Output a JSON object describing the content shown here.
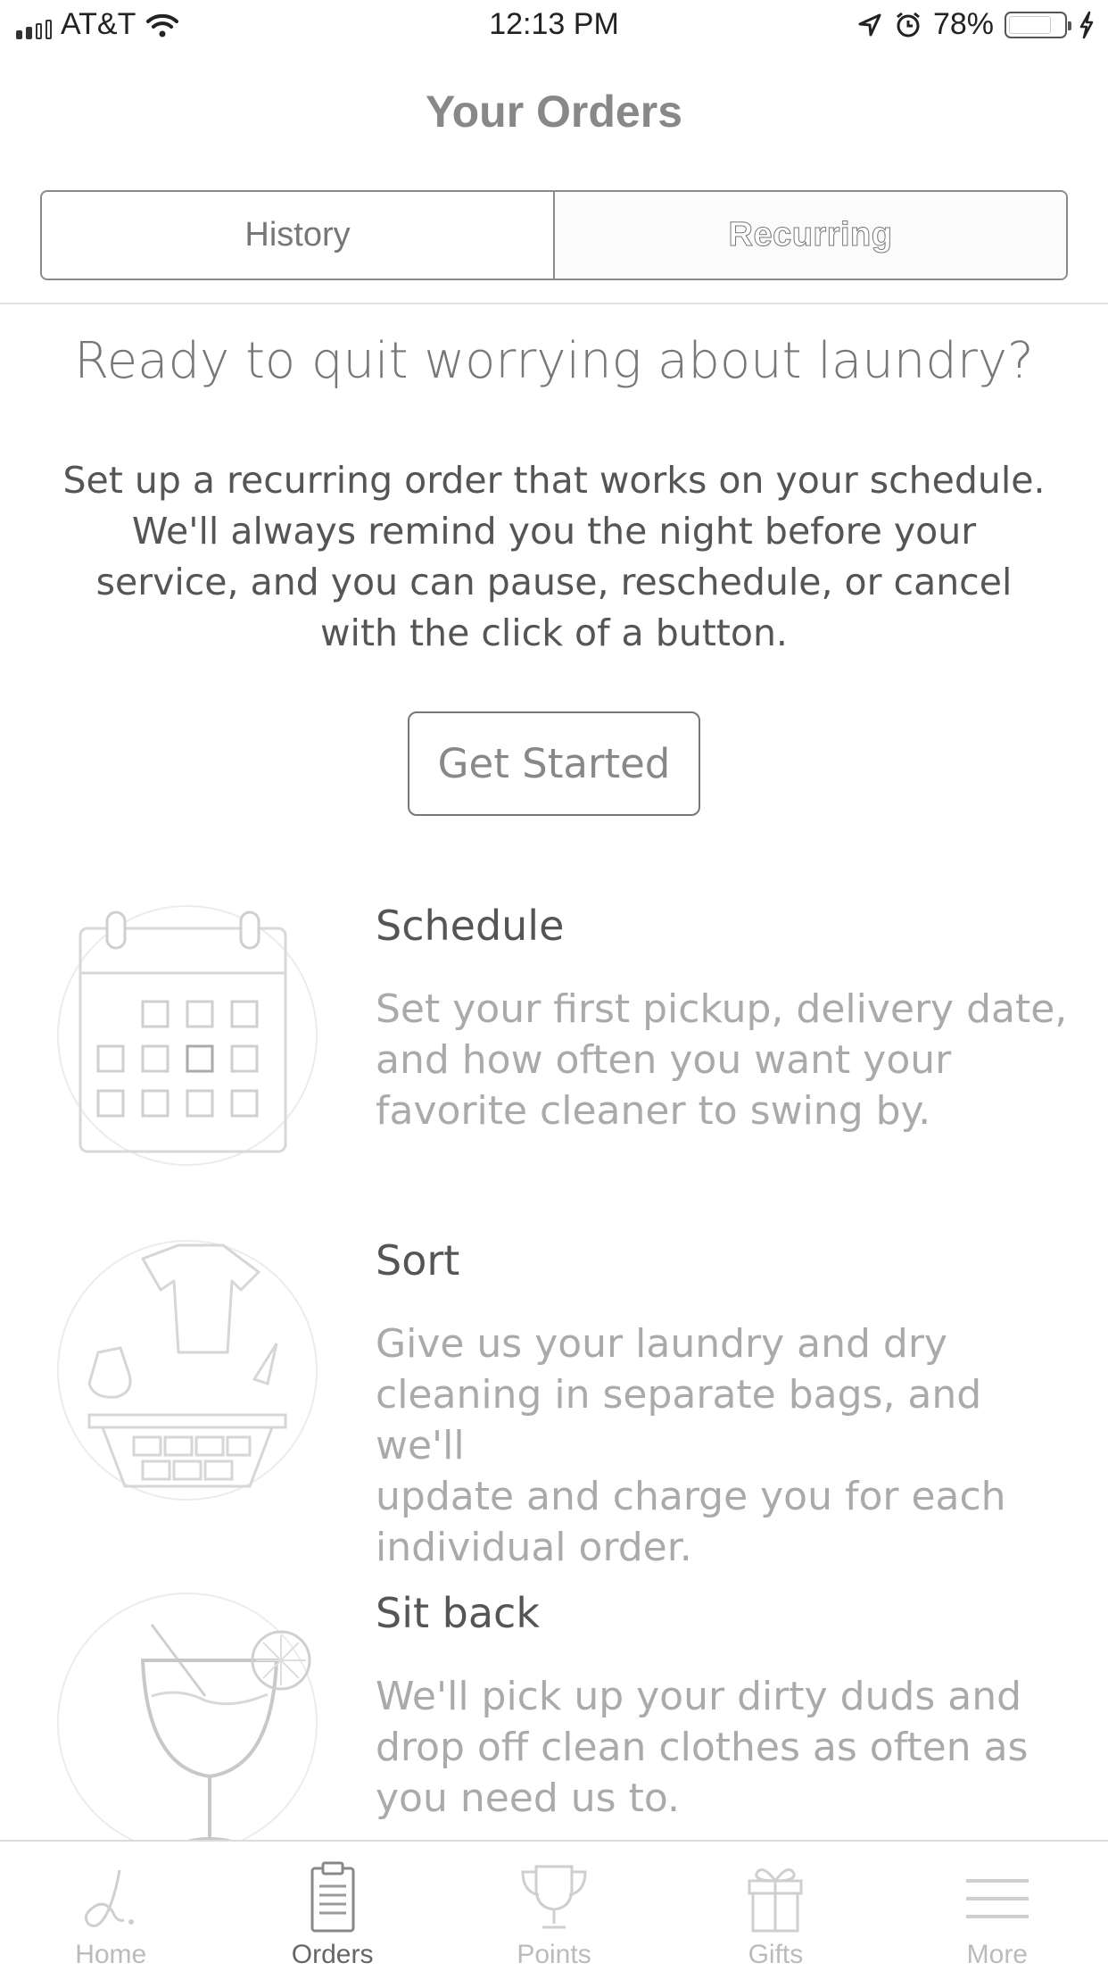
{
  "status_bar": {
    "carrier": "AT&T",
    "time": "12:13 PM",
    "battery_percent": "78%",
    "battery_level": 0.78,
    "icons": [
      "signal-icon",
      "wifi-icon",
      "location-arrow-icon",
      "alarm-icon",
      "battery-icon",
      "charging-bolt-icon"
    ]
  },
  "header": {
    "title": "Your Orders"
  },
  "segments": {
    "history": "History",
    "recurring": "Recurring",
    "selected": "Recurring"
  },
  "intro": {
    "headline": "Ready to quit worrying about laundry?",
    "lines": [
      "Set up a recurring order that works on your schedule.",
      "We'll always remind you the night before your",
      "service, and you can pause, reschedule, or cancel",
      "with the click of a button."
    ],
    "cta_label": "Get Started"
  },
  "features": [
    {
      "title": "Schedule",
      "icon": "calendar-icon",
      "lines": [
        "Set your first pickup, delivery date,",
        "and how often you want your",
        "favorite cleaner to swing by."
      ]
    },
    {
      "title": "Sort",
      "icon": "laundry-basket-icon",
      "lines": [
        "Give us your laundry and dry",
        "cleaning in separate bags, and we'll",
        "update and charge you for each",
        "individual order."
      ]
    },
    {
      "title": "Sit back",
      "icon": "cocktail-icon",
      "lines": [
        "We'll pick up your dirty duds and",
        "drop off clean clothes as often as",
        "you need us to."
      ]
    }
  ],
  "tab_bar": {
    "active": "Orders",
    "tabs": [
      {
        "label": "Home",
        "icon": "home-logo-icon"
      },
      {
        "label": "Orders",
        "icon": "clipboard-icon"
      },
      {
        "label": "Points",
        "icon": "trophy-icon"
      },
      {
        "label": "Gifts",
        "icon": "gift-icon"
      },
      {
        "label": "More",
        "icon": "menu-icon"
      }
    ]
  },
  "colors": {
    "text_dark": "#555555",
    "text_light": "#aaaaaa",
    "border": "#8a8a8a",
    "illustration": "#dddddd"
  }
}
